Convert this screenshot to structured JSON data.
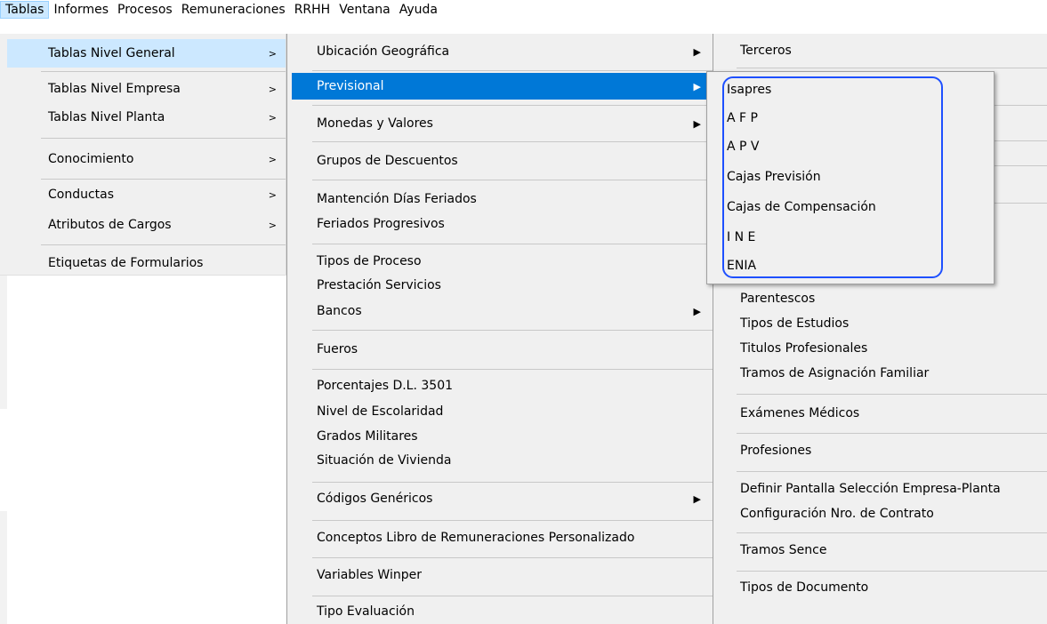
{
  "menubar": {
    "items": [
      "Tablas",
      "Informes",
      "Procesos",
      "Remuneraciones",
      "RRHH",
      "Ventana",
      "Ayuda"
    ]
  },
  "menu_tablas": {
    "items": [
      "Tablas Nivel General",
      "Tablas Nivel Empresa",
      "Tablas Nivel Planta",
      "Conocimiento",
      "Conductas",
      "Atributos de Cargos",
      "Etiquetas de Formularios"
    ],
    "submenu_arrow": ">"
  },
  "menu_general": {
    "items": [
      "Ubicación Geográfica",
      "Previsional",
      "Monedas y Valores",
      "Grupos de Descuentos",
      "Mantención Días Feriados",
      "Feriados Progresivos",
      "Tipos de Proceso",
      "Prestación Servicios",
      "Bancos",
      "Fueros",
      "Porcentajes D.L. 3501",
      "Nivel de Escolaridad",
      "Grados Militares",
      "Situación de Vivienda",
      "Códigos Genéricos",
      "Conceptos Libro de Remuneraciones Personalizado",
      "Variables Winper",
      "Tipo Evaluación"
    ],
    "submenu_arrow": "▶"
  },
  "menu_right": {
    "items": [
      "Terceros",
      "Parentescos",
      "Tipos de Estudios",
      "Titulos Profesionales",
      "Tramos de Asignación Familiar",
      "Exámenes Médicos",
      "Profesiones",
      "Definir Pantalla Selección Empresa-Planta",
      "Configuración Nro. de Contrato",
      "Tramos Sence",
      "Tipos de Documento"
    ]
  },
  "menu_previsional": {
    "items": [
      "Isapres",
      "A F P",
      "A P V",
      "Cajas Previsión",
      "Cajas de Compensación",
      "I N E",
      "ENIA"
    ]
  },
  "colors": {
    "selected": "#0078d7",
    "hover": "#cce8ff",
    "highlight_ring": "#1e50ff"
  }
}
